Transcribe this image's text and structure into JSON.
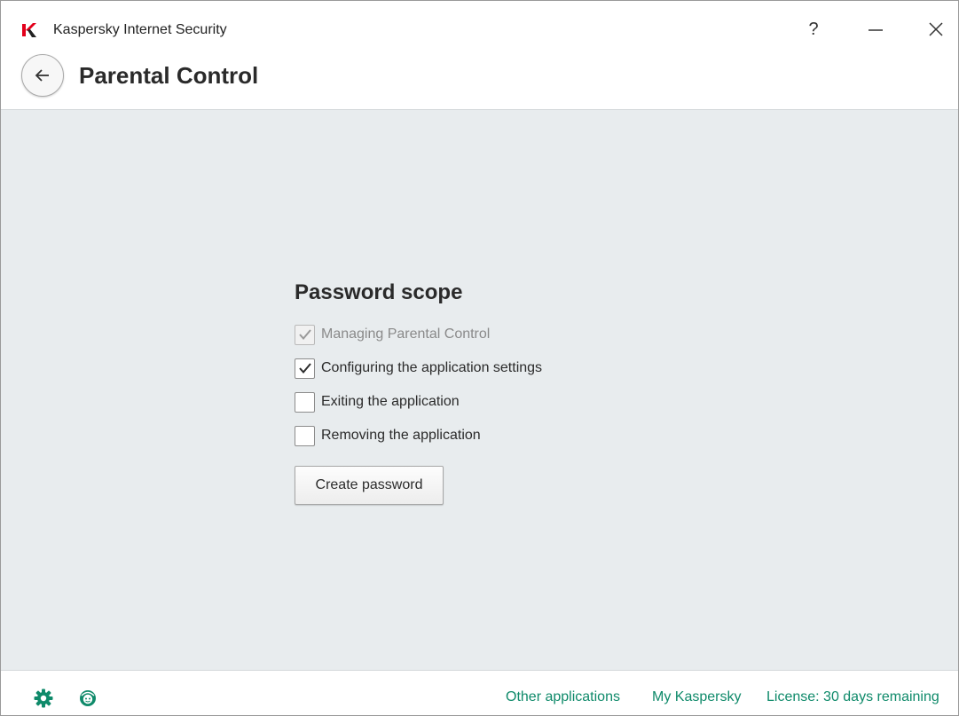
{
  "window": {
    "app_title": "Kaspersky Internet Security",
    "help_label": "?",
    "icons": {
      "app_logo": "kaspersky-logo",
      "minimize": "minimize-icon",
      "close": "close-icon",
      "back": "arrow-left-icon"
    }
  },
  "header": {
    "page_title": "Parental Control"
  },
  "scope": {
    "title": "Password scope",
    "options": [
      {
        "label": "Managing Parental Control",
        "checked": true,
        "disabled": true
      },
      {
        "label": "Configuring the application settings",
        "checked": true,
        "disabled": false
      },
      {
        "label": "Exiting the application",
        "checked": false,
        "disabled": false
      },
      {
        "label": "Removing the application",
        "checked": false,
        "disabled": false
      }
    ],
    "create_button": "Create password"
  },
  "footer": {
    "icons": [
      "settings-icon",
      "support-icon"
    ],
    "links": {
      "other_apps": "Other applications",
      "my_kaspersky": "My Kaspersky",
      "license": "License: 30 days remaining"
    }
  },
  "colors": {
    "accent": "#0f8a6a",
    "content_bg": "#e8ecee",
    "logo_red": "#e3001b"
  }
}
